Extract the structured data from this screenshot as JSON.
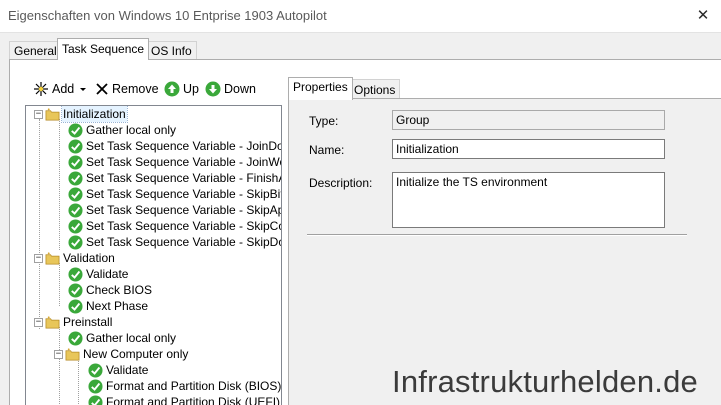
{
  "window": {
    "title": "Eigenschaften von Windows 10 Entprise 1903 Autopilot",
    "close_glyph": "✕"
  },
  "main_tabs": [
    {
      "label": "General",
      "active": false
    },
    {
      "label": "Task Sequence",
      "active": true
    },
    {
      "label": "OS Info",
      "active": false
    }
  ],
  "toolbar": {
    "add_label": "Add",
    "remove_label": "Remove",
    "up_label": "Up",
    "down_label": "Down"
  },
  "tree": [
    {
      "label": "Initialization",
      "type": "group",
      "level": 0,
      "selected": true
    },
    {
      "label": "Gather local only",
      "type": "step",
      "level": 1
    },
    {
      "label": "Set Task Sequence Variable - JoinDomain",
      "type": "step",
      "level": 1
    },
    {
      "label": "Set Task Sequence Variable - JoinWorkgroup",
      "type": "step",
      "level": 1
    },
    {
      "label": "Set Task Sequence Variable - FinishAction",
      "type": "step",
      "level": 1
    },
    {
      "label": "Set Task Sequence Variable - SkipBitLocker",
      "type": "step",
      "level": 1
    },
    {
      "label": "Set Task Sequence Variable - SkipApplications",
      "type": "step",
      "level": 1
    },
    {
      "label": "Set Task Sequence Variable - SkipComputerName",
      "type": "step",
      "level": 1
    },
    {
      "label": "Set Task Sequence Variable - SkipDomainMembership",
      "type": "step",
      "level": 1
    },
    {
      "label": "Validation",
      "type": "group",
      "level": 0
    },
    {
      "label": "Validate",
      "type": "step",
      "level": 1
    },
    {
      "label": "Check BIOS",
      "type": "step",
      "level": 1
    },
    {
      "label": "Next Phase",
      "type": "step",
      "level": 1
    },
    {
      "label": "Preinstall",
      "type": "group",
      "level": 0
    },
    {
      "label": "Gather local only",
      "type": "step",
      "level": 1
    },
    {
      "label": "New Computer only",
      "type": "group",
      "level": 1
    },
    {
      "label": "Validate",
      "type": "step",
      "level": 2
    },
    {
      "label": "Format and Partition Disk (BIOS)",
      "type": "step",
      "level": 2
    },
    {
      "label": "Format and Partition Disk (UEFI)",
      "type": "step",
      "level": 2
    }
  ],
  "sub_tabs": [
    {
      "label": "Properties",
      "active": true
    },
    {
      "label": "Options",
      "active": false
    }
  ],
  "properties": {
    "type_label": "Type:",
    "type_value": "Group",
    "name_label": "Name:",
    "name_value": "Initialization",
    "description_label": "Description:",
    "description_value": "Initialize the TS environment"
  },
  "watermark": "Infrastrukturhelden.de",
  "colors": {
    "step_check": "#3aa83a",
    "folder": "#e8c65a",
    "up_down_circle": "#3aa83a"
  },
  "icons": {
    "add": "star-burst-icon",
    "remove": "x-icon",
    "up": "arrow-up-circle-icon",
    "down": "arrow-down-circle-icon",
    "group": "folder-icon",
    "step": "checkmark-icon"
  }
}
